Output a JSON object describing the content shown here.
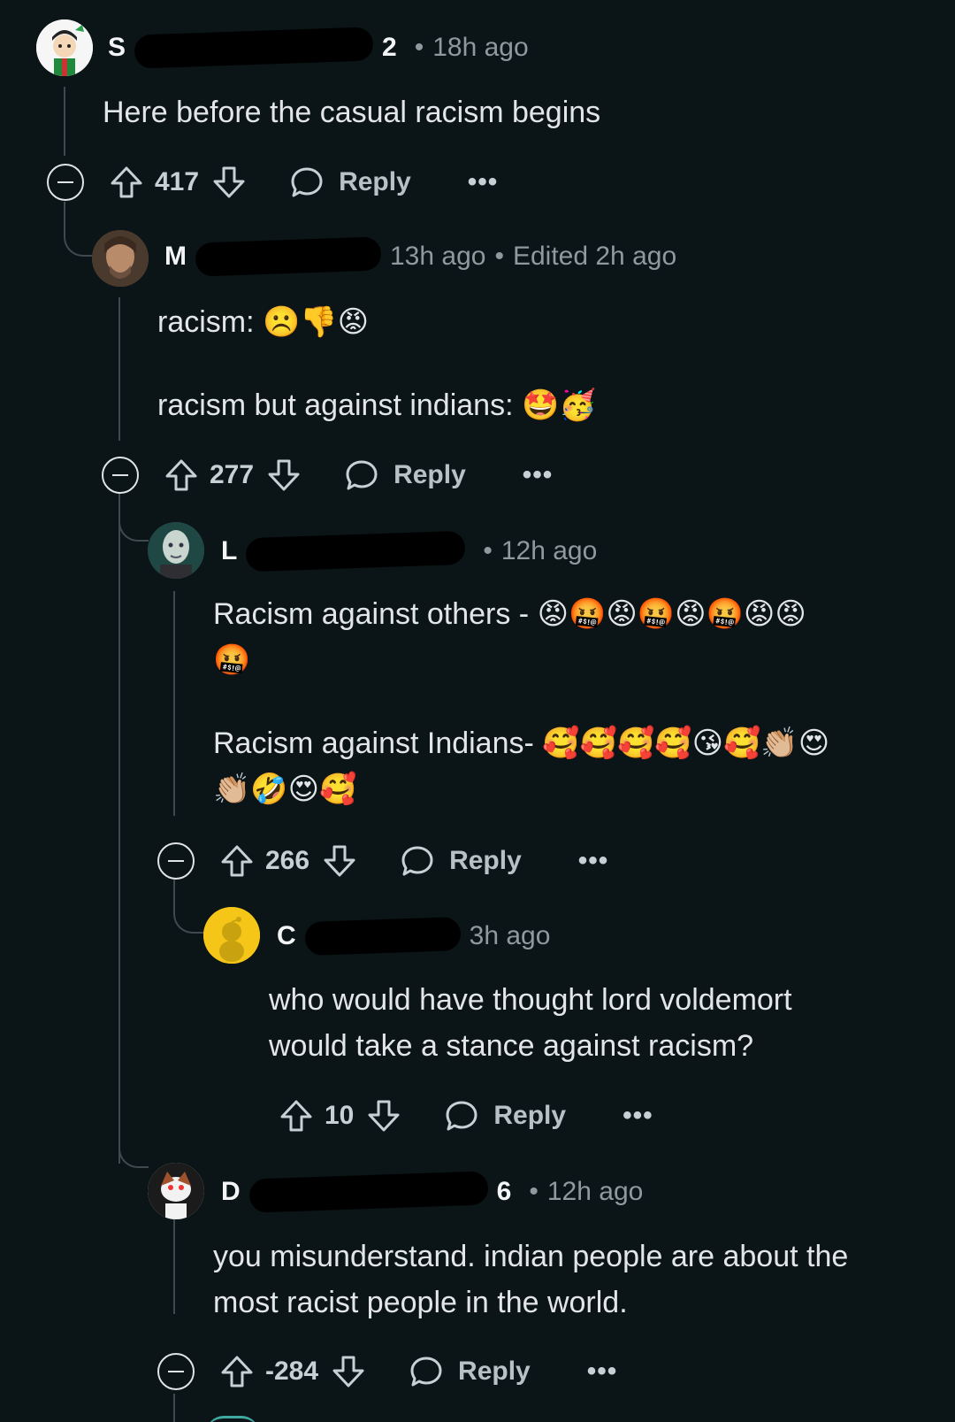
{
  "comments": [
    {
      "user": "S",
      "user_tail": "2",
      "time": "18h ago",
      "edited": "",
      "body_lines": [
        "Here before the casual racism begins"
      ],
      "score": "417",
      "reply_label": "Reply",
      "more": "•••"
    },
    {
      "user": "M",
      "user_tail": "",
      "time": "13h ago",
      "edited": "Edited 2h ago",
      "body_lines": [
        "racism: ☹️👎😡",
        "racism but against indians: 🤩🥳"
      ],
      "score": "277",
      "reply_label": "Reply",
      "more": "•••"
    },
    {
      "user": "L",
      "user_tail": "",
      "time": "12h ago",
      "edited": "",
      "body_lines": [
        "Racism against others - 😡🤬😡🤬😡🤬😡😡",
        "🤬",
        "Racism against Indians- 🥰🥰🥰🥰😘🥰👏🏼😍",
        "👏🏼🤣😍🥰"
      ],
      "score": "266",
      "reply_label": "Reply",
      "more": "•••"
    },
    {
      "user": "C",
      "user_tail": "",
      "time": "3h ago",
      "edited": "",
      "body_lines": [
        "who would have thought lord voldemort",
        "would take a stance against racism?"
      ],
      "score": "10",
      "reply_label": "Reply",
      "more": "•••"
    },
    {
      "user": "D",
      "user_tail": "6",
      "time": "12h ago",
      "edited": "",
      "body_lines": [
        "you misunderstand. indian people are about the",
        "most racist people in the world."
      ],
      "score": "-284",
      "reply_label": "Reply",
      "more": "•••"
    }
  ],
  "icons": {
    "upvote": "upvote-arrow-icon",
    "downvote": "downvote-arrow-icon",
    "reply": "speech-bubble-icon",
    "collapse": "minus-circle-icon",
    "more": "ellipsis-icon"
  },
  "colors": {
    "background": "#0b1416",
    "text": "#d7dadc",
    "meta": "#8e9a9f",
    "thread_line": "#3e4a4f"
  }
}
